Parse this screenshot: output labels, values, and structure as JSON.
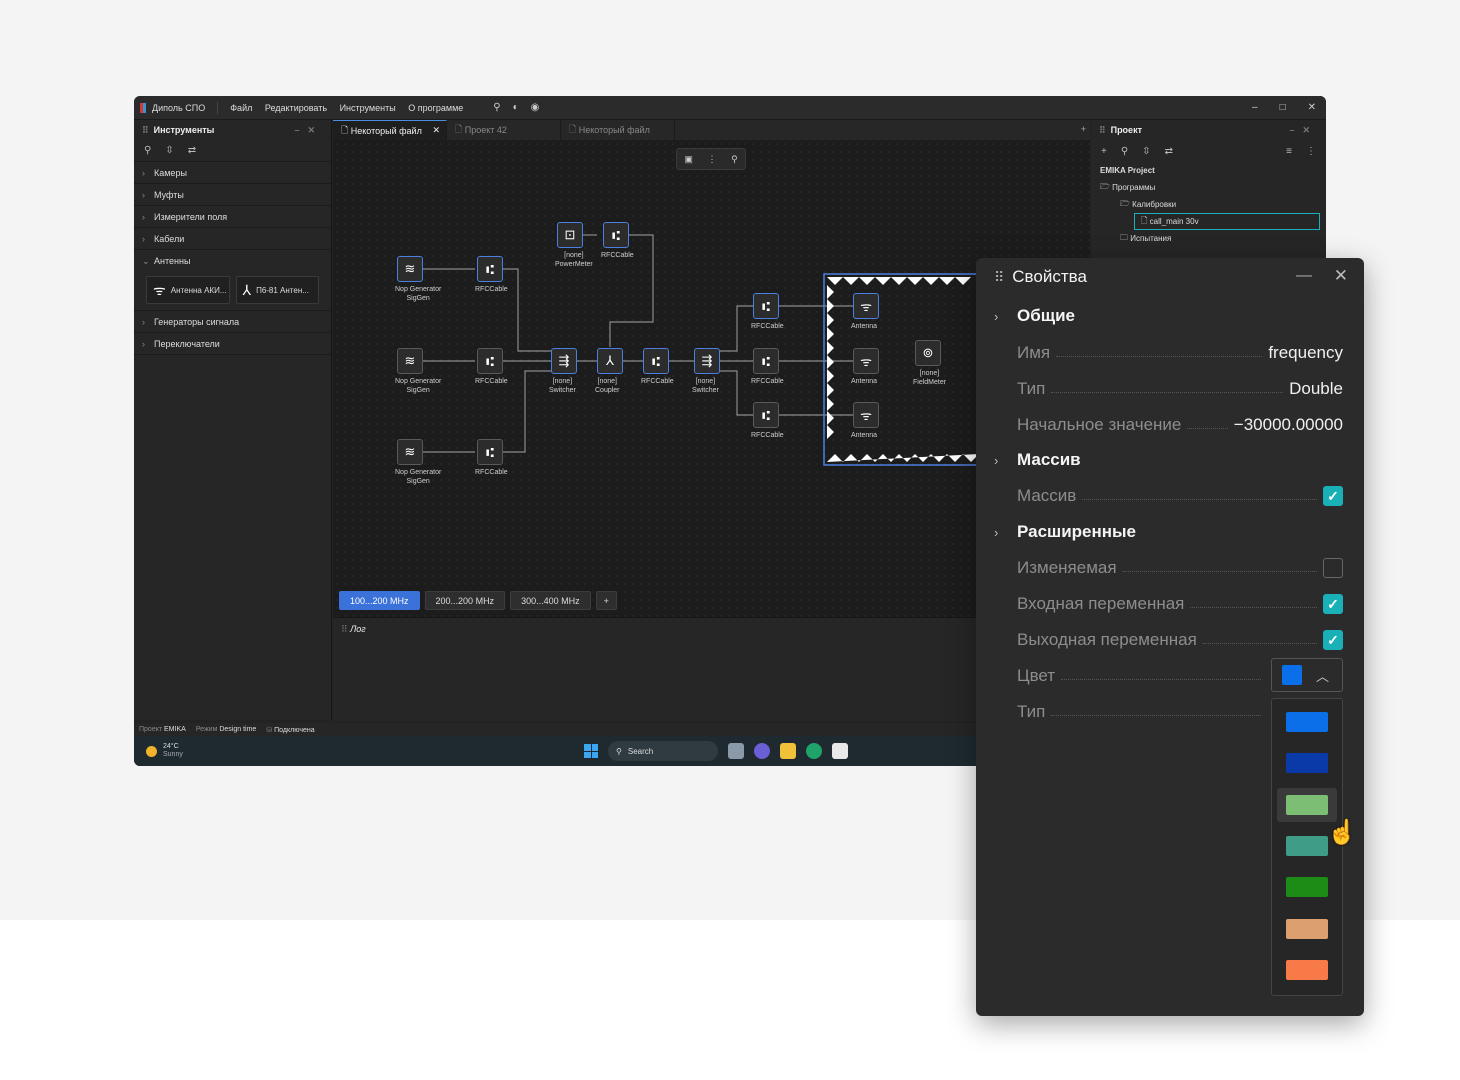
{
  "app": {
    "title": "Диполь СПО",
    "menu": [
      "Файл",
      "Редактировать",
      "Инструменты",
      "О программе"
    ]
  },
  "tools_panel": {
    "title": "Инструменты",
    "categories": [
      "Камеры",
      "Муфты",
      "Измерители поля",
      "Кабели",
      "Антенны",
      "Генераторы сигнала",
      "Переключатели"
    ],
    "antennas": [
      "Антенна АКИ...",
      "П6-81 Антен..."
    ]
  },
  "tabs": [
    "Некоторый файл",
    "Проект 42",
    "Некоторый файл"
  ],
  "canvas": {
    "nodes": [
      {
        "id": "gen1",
        "icon": "≋",
        "label": "Nop Generator\nSigGen",
        "sel": true
      },
      {
        "id": "cab1",
        "icon": "⑆",
        "label": "RFCCable",
        "sel": true
      },
      {
        "id": "pm",
        "icon": "⊡",
        "label": "[none]\nPowerMeter",
        "sel": true
      },
      {
        "id": "cab2",
        "icon": "⑆",
        "label": "RFCCable",
        "sel": true
      },
      {
        "id": "gen2",
        "icon": "≋",
        "label": "Nop Generator\nSigGen",
        "sel": false
      },
      {
        "id": "cab3",
        "icon": "⑆",
        "label": "RFCCable",
        "sel": false
      },
      {
        "id": "sw1",
        "icon": "⇶",
        "label": "[none]\nSwitcher",
        "sel": true
      },
      {
        "id": "cp",
        "icon": "⅄",
        "label": "[none]\nCoupler",
        "sel": true
      },
      {
        "id": "cab4",
        "icon": "⑆",
        "label": "RFCCable",
        "sel": true
      },
      {
        "id": "sw2",
        "icon": "⇶",
        "label": "[none]\nSwitcher",
        "sel": true
      },
      {
        "id": "gen3",
        "icon": "≋",
        "label": "Nop Generator\nSigGen",
        "sel": false
      },
      {
        "id": "cab5",
        "icon": "⑆",
        "label": "RFCCable",
        "sel": false
      },
      {
        "id": "cab6",
        "icon": "⑆",
        "label": "RFCCable",
        "sel": true
      },
      {
        "id": "cab7",
        "icon": "⑆",
        "label": "RFCCable",
        "sel": false
      },
      {
        "id": "cab8",
        "icon": "⑆",
        "label": "RFCCable",
        "sel": false
      },
      {
        "id": "ant1",
        "icon": "ᯤ",
        "label": "Antenna",
        "sel": true
      },
      {
        "id": "ant2",
        "icon": "ᯤ",
        "label": "Antenna",
        "sel": false
      },
      {
        "id": "ant3",
        "icon": "ᯤ",
        "label": "Antenna",
        "sel": false
      },
      {
        "id": "fm",
        "icon": "⊚",
        "label": "[none]\nFieldMeter",
        "sel": false
      }
    ],
    "freq_tabs": [
      "100...200 MHz",
      "200...200 MHz",
      "300...400 MHz"
    ]
  },
  "log": {
    "title": "Лог"
  },
  "project": {
    "title": "Проект",
    "root": "EMIKA Project",
    "programs": "Программы",
    "calibrations": "Калибровки",
    "file": "call_main 30v",
    "tests": "Испытания"
  },
  "status": {
    "project_label": "Проект",
    "project": "EMIKA",
    "mode_label": "Режим",
    "mode": "Design time",
    "connection": "Подключена"
  },
  "taskbar": {
    "temp": "24°C",
    "weather": "Sunny",
    "search": "Search"
  },
  "properties": {
    "title": "Свойства",
    "sections": {
      "general": "Общие",
      "array": "Массив",
      "extended": "Расширенные"
    },
    "name_label": "Имя",
    "name": "frequency",
    "type_label": "Тип",
    "type": "Double",
    "init_label": "Начальное значение",
    "init": "−30000.00000",
    "array_label": "Массив",
    "array": true,
    "mutable_label": "Изменяемая",
    "mutable": false,
    "input_label": "Входная переменная",
    "input": true,
    "output_label": "Выходная переменная",
    "output": true,
    "color_label": "Цвет",
    "color": "#0a6fe8",
    "type2_label": "Тип",
    "color_options": [
      "#0a6fe8",
      "#0a3aa8",
      "#7cbf74",
      "#3f9c86",
      "#1c8c16",
      "#dca070",
      "#f77a48"
    ],
    "highlighted_option": 2
  }
}
